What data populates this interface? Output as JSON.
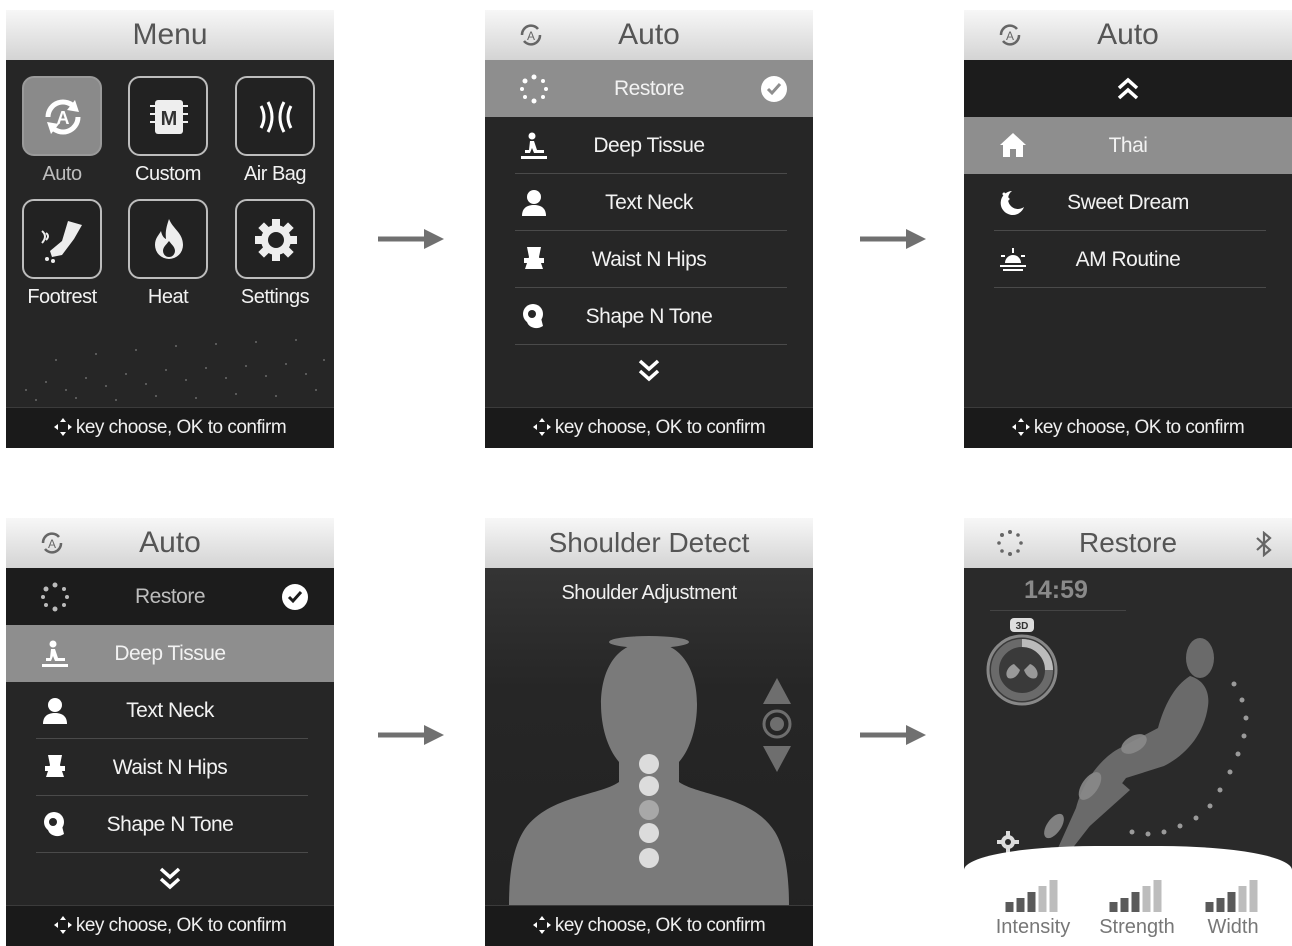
{
  "footer_hint": "key choose, OK to confirm",
  "panel_menu": {
    "title": "Menu",
    "tiles": [
      {
        "label": "Auto",
        "icon": "auto-icon",
        "active": true
      },
      {
        "label": "Custom",
        "icon": "custom-icon"
      },
      {
        "label": "Air Bag",
        "icon": "airbag-icon"
      },
      {
        "label": "Footrest",
        "icon": "footrest-icon"
      },
      {
        "label": "Heat",
        "icon": "heat-icon"
      },
      {
        "label": "Settings",
        "icon": "settings-icon"
      }
    ]
  },
  "panel_auto1": {
    "title": "Auto",
    "items": [
      {
        "label": "Restore",
        "icon": "restore-icon",
        "selected": true,
        "checked": true
      },
      {
        "label": "Deep Tissue",
        "icon": "deep-tissue-icon"
      },
      {
        "label": "Text Neck",
        "icon": "text-neck-icon"
      },
      {
        "label": "Waist N Hips",
        "icon": "waist-hips-icon"
      },
      {
        "label": "Shape N Tone",
        "icon": "shape-tone-icon"
      }
    ]
  },
  "panel_auto2": {
    "title": "Auto",
    "items": [
      {
        "label": "Thai",
        "icon": "thai-icon",
        "selected": true
      },
      {
        "label": "Sweet Dream",
        "icon": "sweet-dream-icon"
      },
      {
        "label": "AM Routine",
        "icon": "am-routine-icon"
      }
    ]
  },
  "panel_auto3": {
    "title": "Auto",
    "items": [
      {
        "label": "Restore",
        "icon": "restore-icon",
        "checked": true
      },
      {
        "label": "Deep Tissue",
        "icon": "deep-tissue-icon",
        "selected": true
      },
      {
        "label": "Text Neck",
        "icon": "text-neck-icon"
      },
      {
        "label": "Waist N Hips",
        "icon": "waist-hips-icon"
      },
      {
        "label": "Shape N Tone",
        "icon": "shape-tone-icon"
      }
    ]
  },
  "panel_shoulder": {
    "title": "Shoulder Detect",
    "subtitle": "Shoulder Adjustment"
  },
  "panel_restore": {
    "title": "Restore",
    "timer": "14:59",
    "badge": "3D",
    "sliders": [
      {
        "label": "Intensity",
        "level": 0.6
      },
      {
        "label": "Strength",
        "level": 0.6
      },
      {
        "label": "Width",
        "level": 0.6
      }
    ]
  },
  "colors": {
    "accent": "#8e8e8e",
    "panel": "#262626",
    "header": "#e6e6e6",
    "arrow": "#707070"
  }
}
